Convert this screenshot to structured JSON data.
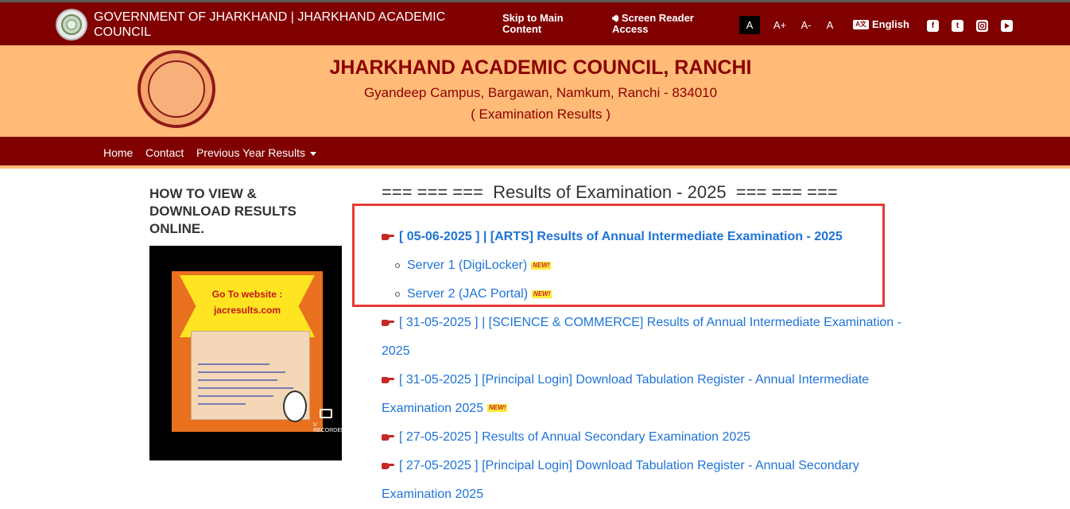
{
  "topbar": {
    "gov_title": "GOVERNMENT OF JHARKHAND | JHARKHAND ACADEMIC COUNCIL",
    "skip_label": "Skip to Main Content",
    "screen_reader_label": "Screen Reader Access",
    "font_sizes": [
      "A",
      "A+",
      "A-",
      "A"
    ],
    "language_label": "English",
    "language_icon": "A文",
    "social_icons": [
      "facebook-icon",
      "twitter-icon",
      "instagram-icon",
      "youtube-icon"
    ]
  },
  "header": {
    "name": "JHARKHAND ACADEMIC COUNCIL, RANCHI",
    "address": "Gyandeep Campus, Bargawan, Namkum, Ranchi - 834010",
    "subtitle": "( Examination Results )"
  },
  "nav": {
    "home": "Home",
    "contact": "Contact",
    "previous": "Previous Year Results"
  },
  "sidebar": {
    "howto_title": "HOW TO VIEW & DOWNLOAD RESULTS ONLINE.",
    "video_text1": "Go To website :",
    "video_text2": "jacresults.com",
    "video_recorder_label": "V RECORDER"
  },
  "main": {
    "section_title": "=== === ===  Results of Examination - 2025  === === ===",
    "new_label": "NEW!",
    "featured": {
      "text": "[ 05-06-2025 ]  |  [ARTS]   Results of Annual Intermediate Examination - 2025",
      "servers": [
        "Server 1 (DigiLocker)",
        "Server 2 (JAC Portal)"
      ]
    },
    "results": [
      {
        "line1": "[ 31-05-2025 ]  |  [SCIENCE & COMMERCE]   Results of Annual Intermediate Examination -",
        "line2": "2025"
      },
      {
        "line1": "[ 31-05-2025 ]   [Principal Login] Download Tabulation Register - Annual Intermediate",
        "line2": "Examination 2025"
      },
      {
        "line1": "[ 27-05-2025 ]   Results of Annual Secondary Examination 2025"
      },
      {
        "line1": "[ 27-05-2025 ]   [Principal Login] Download Tabulation Register - Annual Secondary",
        "line2": "Examination 2025"
      }
    ]
  },
  "colors": {
    "maroon": "#800000",
    "peach": "#ffbb77",
    "link_blue": "#1e73d6",
    "highlight_red": "#e53935"
  }
}
